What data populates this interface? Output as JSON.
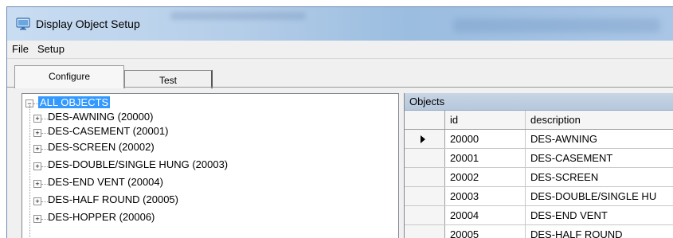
{
  "window": {
    "title": "Display Object Setup",
    "icon": "monitor-icon"
  },
  "menu": {
    "items": [
      {
        "label": "File"
      },
      {
        "label": "Setup"
      }
    ]
  },
  "tabs": [
    {
      "label": "Configure",
      "selected": true
    },
    {
      "label": "Test",
      "selected": false
    }
  ],
  "tree": {
    "root": {
      "label": "ALL OBJECTS",
      "expanded": true
    },
    "nodes": [
      {
        "label": "DES-AWNING (20000)"
      },
      {
        "label": "DES-CASEMENT (20001)"
      },
      {
        "label": "DES-SCREEN (20002)"
      },
      {
        "label": "DES-DOUBLE/SINGLE HUNG (20003)"
      },
      {
        "label": "DES-END VENT (20004)"
      },
      {
        "label": "DES-HALF ROUND (20005)"
      },
      {
        "label": "DES-HOPPER (20006)"
      }
    ]
  },
  "grid": {
    "caption": "Objects",
    "columns": [
      "id",
      "description"
    ],
    "rows": [
      {
        "id": "20000",
        "description": "DES-AWNING",
        "current": true
      },
      {
        "id": "20001",
        "description": "DES-CASEMENT"
      },
      {
        "id": "20002",
        "description": "DES-SCREEN"
      },
      {
        "id": "20003",
        "description": "DES-DOUBLE/SINGLE HU"
      },
      {
        "id": "20004",
        "description": "DES-END VENT"
      },
      {
        "id": "20005",
        "description": "DES-HALF ROUND"
      }
    ]
  },
  "colors": {
    "selection": "#3399ff",
    "title_bar": "#b4cde8",
    "grid_caption": "#c7d5e4"
  }
}
